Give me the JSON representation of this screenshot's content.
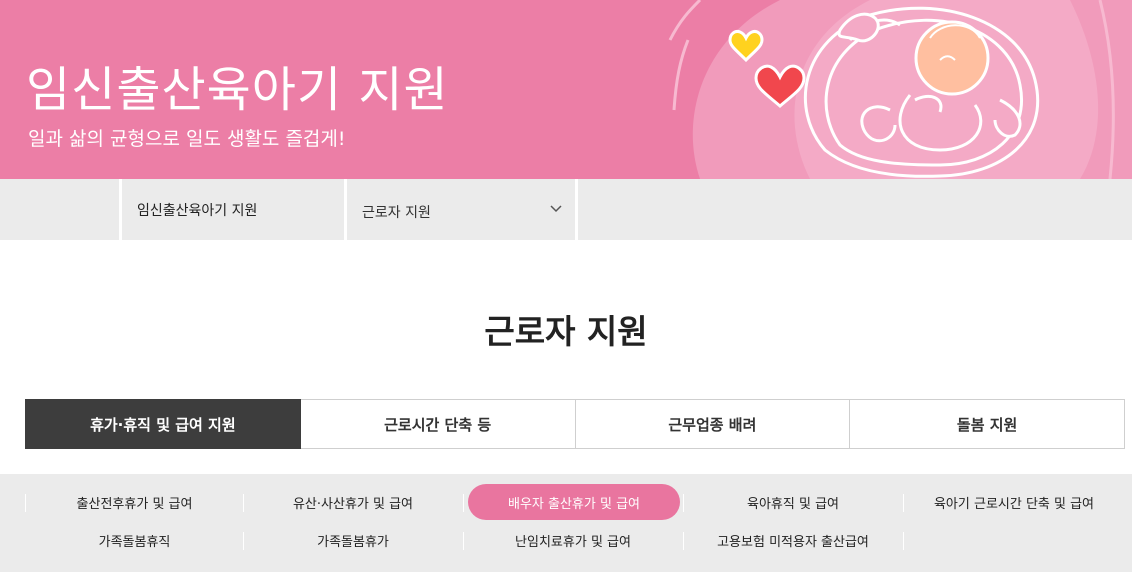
{
  "hero": {
    "title": "임신출산육아기 지원",
    "subtitle": "일과 삶의 균형으로 일도 생활도 즐겁게!"
  },
  "subnav": {
    "home_label": "임신출산육아기 지원",
    "selected": "근로자 지원",
    "dropdown_icon": "chevron-down-icon"
  },
  "page": {
    "title": "근로자 지원"
  },
  "tabs": [
    {
      "label": "휴가·휴직 및 급여 지원",
      "active": true
    },
    {
      "label": "근로시간 단축 등",
      "active": false
    },
    {
      "label": "근무업종 배려",
      "active": false
    },
    {
      "label": "돌봄 지원",
      "active": false
    }
  ],
  "subtabs": [
    {
      "label": "출산전후휴가 및 급여",
      "active": false
    },
    {
      "label": "유산·사산휴가 및 급여",
      "active": false
    },
    {
      "label": "배우자 출산휴가 및 급여",
      "active": true
    },
    {
      "label": "육아휴직 및 급여",
      "active": false
    },
    {
      "label": "육아기 근로시간 단축 및 급여",
      "active": false
    },
    {
      "label": "가족돌봄휴직",
      "active": false
    },
    {
      "label": "가족돌봄휴가",
      "active": false
    },
    {
      "label": "난임치료휴가 및 급여",
      "active": false
    },
    {
      "label": "고용보험 미적용자 출산급여",
      "active": false
    }
  ],
  "colors": {
    "hero_bg": "#ec7ea6",
    "active_tab_bg": "#3d3d3d",
    "active_subtab_bg": "#e9759f",
    "subnav_bg": "#ebebeb"
  }
}
